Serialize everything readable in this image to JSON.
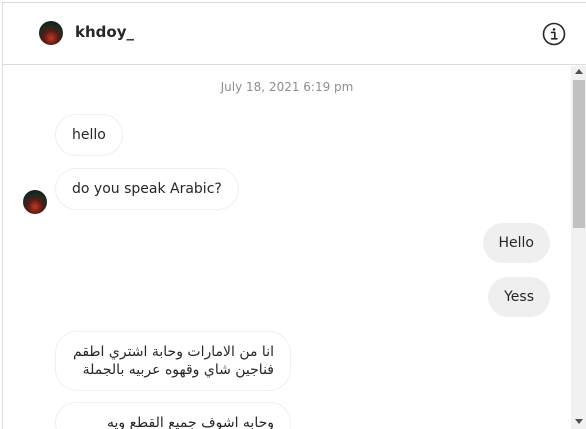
{
  "header": {
    "username": "khdoy_",
    "info_icon": "info-circle-icon"
  },
  "thread": {
    "timestamp": "July 18, 2021 6:19 pm",
    "messages": [
      {
        "from": "them",
        "text": "hello"
      },
      {
        "from": "them",
        "text": "do you speak Arabic?"
      },
      {
        "from": "me",
        "text": "Hello"
      },
      {
        "from": "me",
        "text": "Yess"
      },
      {
        "from": "them",
        "text": "انا من الامارات وحابة اشتري اطقم فناجين شاي وقهوه عربيه بالجملة"
      },
      {
        "from": "them",
        "text": "وحابه اشوف جميع القطع ويه"
      }
    ]
  },
  "colors": {
    "border": "#dbdbdb",
    "outgoing_bubble": "#efefef",
    "incoming_border": "#efefef",
    "timestamp": "#8e8e8e",
    "text": "#262626"
  }
}
